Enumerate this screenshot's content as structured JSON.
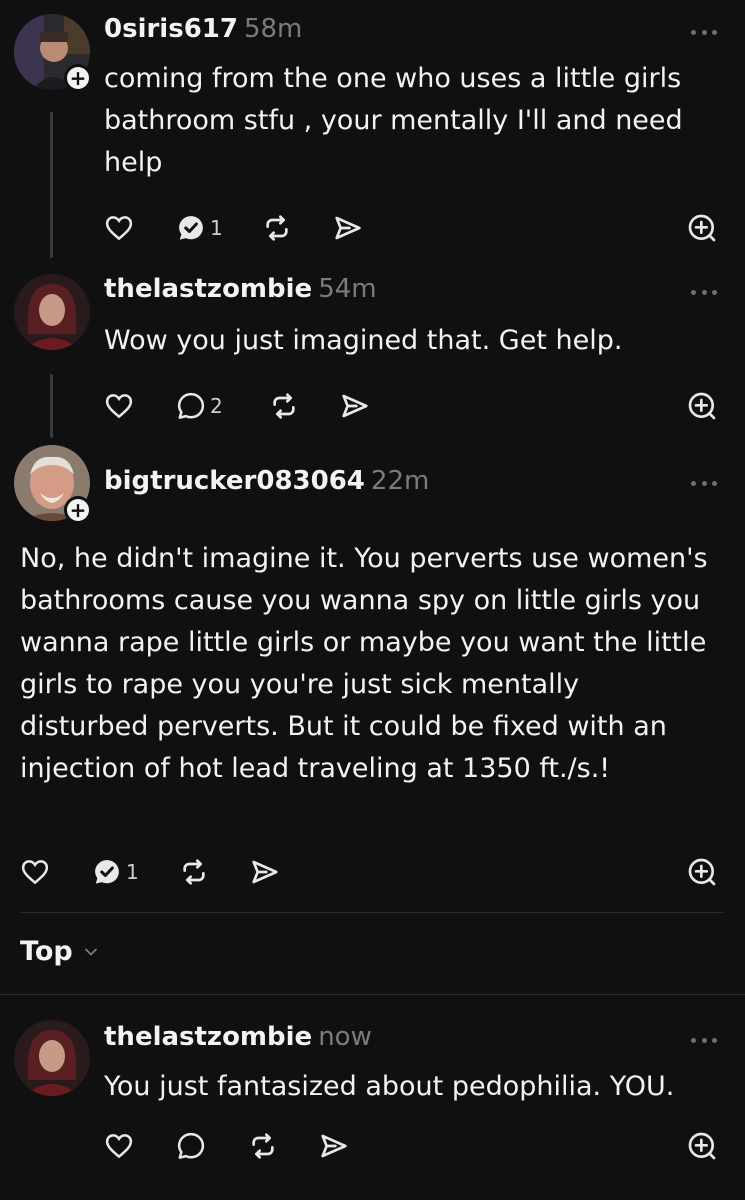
{
  "posts": [
    {
      "username": "0siris617",
      "time": "58m",
      "text": "coming from the one who uses a little girls bathroom stfu , your mentally I'll and need help",
      "reply_count": "1"
    },
    {
      "username": "thelastzombie",
      "time": "54m",
      "text": "Wow you just imagined that. Get help.",
      "reply_count": "2"
    },
    {
      "username": "bigtrucker083064",
      "time": "22m",
      "text": "No, he didn't imagine it. You perverts use women's bathrooms cause you wanna spy on little girls you wanna rape little girls or maybe you want the little girls to rape you you're just sick mentally disturbed perverts. But it could be fixed with an injection of hot lead traveling at 1350 ft./s.!",
      "reply_count": "1"
    },
    {
      "username": "thelastzombie",
      "time": "now",
      "text": "You just fantasized about pedophilia. YOU.",
      "reply_count": ""
    }
  ],
  "sort": {
    "label": "Top"
  },
  "icons": {
    "like": "heart-icon",
    "reply": "speech-bubble-icon",
    "replied": "speech-bubble-check-icon",
    "repost": "repost-icon",
    "share": "send-icon",
    "quote": "add-circle-icon",
    "follow": "plus-icon",
    "more": "ellipsis-icon",
    "sort": "chevron-down-icon"
  },
  "colors": {
    "background": "#101010",
    "text": "#f3f3f3",
    "muted": "#7b7b7b"
  }
}
